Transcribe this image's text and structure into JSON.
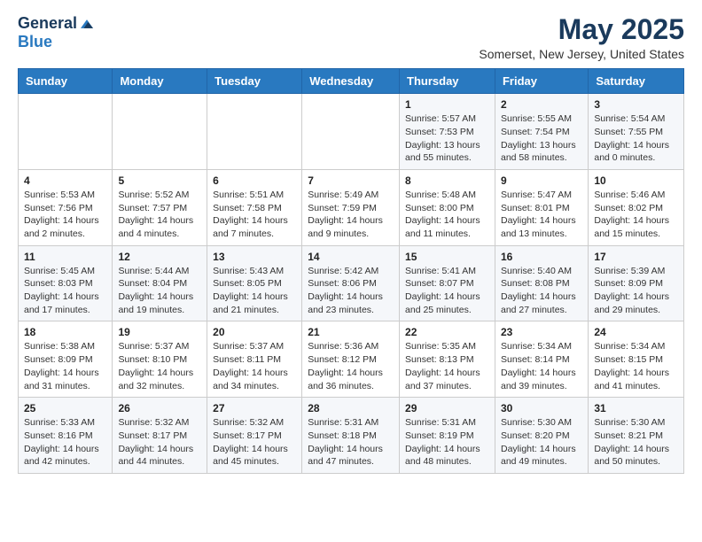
{
  "header": {
    "logo_general": "General",
    "logo_blue": "Blue",
    "month_title": "May 2025",
    "location": "Somerset, New Jersey, United States"
  },
  "weekdays": [
    "Sunday",
    "Monday",
    "Tuesday",
    "Wednesday",
    "Thursday",
    "Friday",
    "Saturday"
  ],
  "weeks": [
    [
      {
        "day": "",
        "info": ""
      },
      {
        "day": "",
        "info": ""
      },
      {
        "day": "",
        "info": ""
      },
      {
        "day": "",
        "info": ""
      },
      {
        "day": "1",
        "info": "Sunrise: 5:57 AM\nSunset: 7:53 PM\nDaylight: 13 hours\nand 55 minutes."
      },
      {
        "day": "2",
        "info": "Sunrise: 5:55 AM\nSunset: 7:54 PM\nDaylight: 13 hours\nand 58 minutes."
      },
      {
        "day": "3",
        "info": "Sunrise: 5:54 AM\nSunset: 7:55 PM\nDaylight: 14 hours\nand 0 minutes."
      }
    ],
    [
      {
        "day": "4",
        "info": "Sunrise: 5:53 AM\nSunset: 7:56 PM\nDaylight: 14 hours\nand 2 minutes."
      },
      {
        "day": "5",
        "info": "Sunrise: 5:52 AM\nSunset: 7:57 PM\nDaylight: 14 hours\nand 4 minutes."
      },
      {
        "day": "6",
        "info": "Sunrise: 5:51 AM\nSunset: 7:58 PM\nDaylight: 14 hours\nand 7 minutes."
      },
      {
        "day": "7",
        "info": "Sunrise: 5:49 AM\nSunset: 7:59 PM\nDaylight: 14 hours\nand 9 minutes."
      },
      {
        "day": "8",
        "info": "Sunrise: 5:48 AM\nSunset: 8:00 PM\nDaylight: 14 hours\nand 11 minutes."
      },
      {
        "day": "9",
        "info": "Sunrise: 5:47 AM\nSunset: 8:01 PM\nDaylight: 14 hours\nand 13 minutes."
      },
      {
        "day": "10",
        "info": "Sunrise: 5:46 AM\nSunset: 8:02 PM\nDaylight: 14 hours\nand 15 minutes."
      }
    ],
    [
      {
        "day": "11",
        "info": "Sunrise: 5:45 AM\nSunset: 8:03 PM\nDaylight: 14 hours\nand 17 minutes."
      },
      {
        "day": "12",
        "info": "Sunrise: 5:44 AM\nSunset: 8:04 PM\nDaylight: 14 hours\nand 19 minutes."
      },
      {
        "day": "13",
        "info": "Sunrise: 5:43 AM\nSunset: 8:05 PM\nDaylight: 14 hours\nand 21 minutes."
      },
      {
        "day": "14",
        "info": "Sunrise: 5:42 AM\nSunset: 8:06 PM\nDaylight: 14 hours\nand 23 minutes."
      },
      {
        "day": "15",
        "info": "Sunrise: 5:41 AM\nSunset: 8:07 PM\nDaylight: 14 hours\nand 25 minutes."
      },
      {
        "day": "16",
        "info": "Sunrise: 5:40 AM\nSunset: 8:08 PM\nDaylight: 14 hours\nand 27 minutes."
      },
      {
        "day": "17",
        "info": "Sunrise: 5:39 AM\nSunset: 8:09 PM\nDaylight: 14 hours\nand 29 minutes."
      }
    ],
    [
      {
        "day": "18",
        "info": "Sunrise: 5:38 AM\nSunset: 8:09 PM\nDaylight: 14 hours\nand 31 minutes."
      },
      {
        "day": "19",
        "info": "Sunrise: 5:37 AM\nSunset: 8:10 PM\nDaylight: 14 hours\nand 32 minutes."
      },
      {
        "day": "20",
        "info": "Sunrise: 5:37 AM\nSunset: 8:11 PM\nDaylight: 14 hours\nand 34 minutes."
      },
      {
        "day": "21",
        "info": "Sunrise: 5:36 AM\nSunset: 8:12 PM\nDaylight: 14 hours\nand 36 minutes."
      },
      {
        "day": "22",
        "info": "Sunrise: 5:35 AM\nSunset: 8:13 PM\nDaylight: 14 hours\nand 37 minutes."
      },
      {
        "day": "23",
        "info": "Sunrise: 5:34 AM\nSunset: 8:14 PM\nDaylight: 14 hours\nand 39 minutes."
      },
      {
        "day": "24",
        "info": "Sunrise: 5:34 AM\nSunset: 8:15 PM\nDaylight: 14 hours\nand 41 minutes."
      }
    ],
    [
      {
        "day": "25",
        "info": "Sunrise: 5:33 AM\nSunset: 8:16 PM\nDaylight: 14 hours\nand 42 minutes."
      },
      {
        "day": "26",
        "info": "Sunrise: 5:32 AM\nSunset: 8:17 PM\nDaylight: 14 hours\nand 44 minutes."
      },
      {
        "day": "27",
        "info": "Sunrise: 5:32 AM\nSunset: 8:17 PM\nDaylight: 14 hours\nand 45 minutes."
      },
      {
        "day": "28",
        "info": "Sunrise: 5:31 AM\nSunset: 8:18 PM\nDaylight: 14 hours\nand 47 minutes."
      },
      {
        "day": "29",
        "info": "Sunrise: 5:31 AM\nSunset: 8:19 PM\nDaylight: 14 hours\nand 48 minutes."
      },
      {
        "day": "30",
        "info": "Sunrise: 5:30 AM\nSunset: 8:20 PM\nDaylight: 14 hours\nand 49 minutes."
      },
      {
        "day": "31",
        "info": "Sunrise: 5:30 AM\nSunset: 8:21 PM\nDaylight: 14 hours\nand 50 minutes."
      }
    ]
  ]
}
